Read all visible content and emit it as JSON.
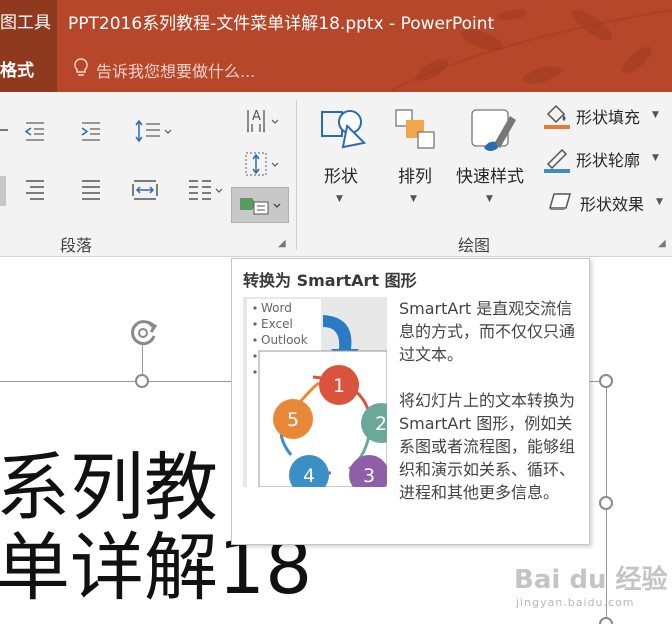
{
  "titlebar": {
    "tools_tab": "图工具",
    "format_tab": "格式",
    "document_title": "PPT2016系列教程-文件菜单详解18.pptx - PowerPoint",
    "tell_me_placeholder": "告诉我您想要做什么...",
    "background_color": "#b7472a"
  },
  "ribbon": {
    "paragraph_group": {
      "label": "段落",
      "icons": [
        "decrease-indent-icon",
        "increase-indent-icon",
        "line-spacing-icon",
        "text-direction-icon",
        "align-text-icon",
        "align-right-icon",
        "justify-icon",
        "distributed-icon",
        "columns-icon",
        "convert-to-smartart-icon"
      ]
    },
    "drawing_group": {
      "label": "绘图",
      "shapes_label": "形状",
      "arrange_label": "排列",
      "quick_styles_label": "快速样式",
      "shape_fill_label": "形状填充",
      "shape_outline_label": "形状轮廓",
      "shape_effects_label": "形状效果"
    }
  },
  "slide": {
    "title_lines": [
      "系列教",
      "单详解18"
    ]
  },
  "tooltip": {
    "title": "转换为 SmartArt 图形",
    "thumbnail_bullets": [
      "Word",
      "Excel",
      "Outlook"
    ],
    "thumbnail_cycle": [
      "1",
      "2",
      "3",
      "4",
      "5"
    ],
    "description_1": "SmartArt 是直观交流信息的方式，而不仅仅只通过文本。",
    "description_2": "将幻灯片上的文本转换为 SmartArt 图形，例如关系图或者流程图，能够组织和演示如关系、循环、进程和其他更多信息。"
  },
  "watermark": {
    "brand": "Bai du 经验",
    "url": "jingyan.baidu.com"
  },
  "colors": {
    "accent": "#b7472a",
    "cycle_red": "#d9533d",
    "cycle_teal": "#6aa89a",
    "cycle_purple": "#8e5ea8",
    "cycle_blue": "#3a8fc4",
    "cycle_orange": "#e8893a"
  }
}
